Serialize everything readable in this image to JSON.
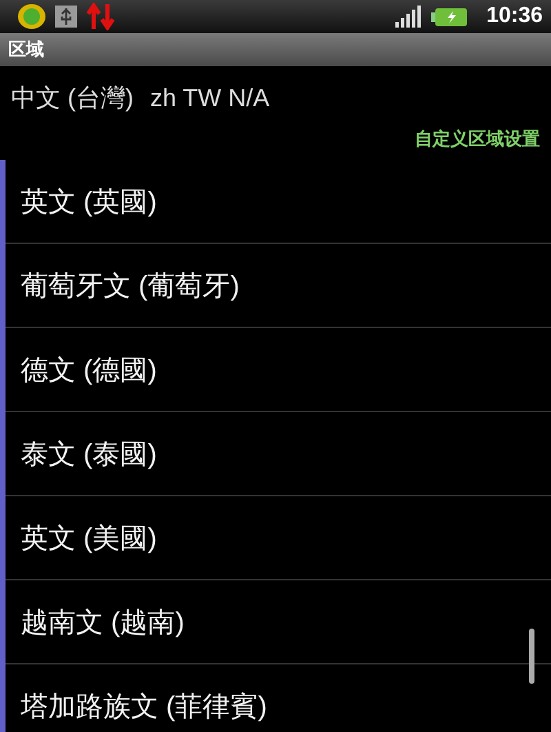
{
  "status_bar": {
    "time": "10:36"
  },
  "window": {
    "title": "区域"
  },
  "current_locale": {
    "name": "中文 (台灣)",
    "code": "zh TW N/A"
  },
  "custom_link": "自定义区域设置",
  "items": [
    {
      "label": "英文 (英國)"
    },
    {
      "label": "葡萄牙文 (葡萄牙)"
    },
    {
      "label": "德文 (德國)"
    },
    {
      "label": "泰文 (泰國)"
    },
    {
      "label": "英文 (美國)"
    },
    {
      "label": "越南文 (越南)"
    },
    {
      "label": "塔加路族文 (菲律賓)"
    }
  ]
}
